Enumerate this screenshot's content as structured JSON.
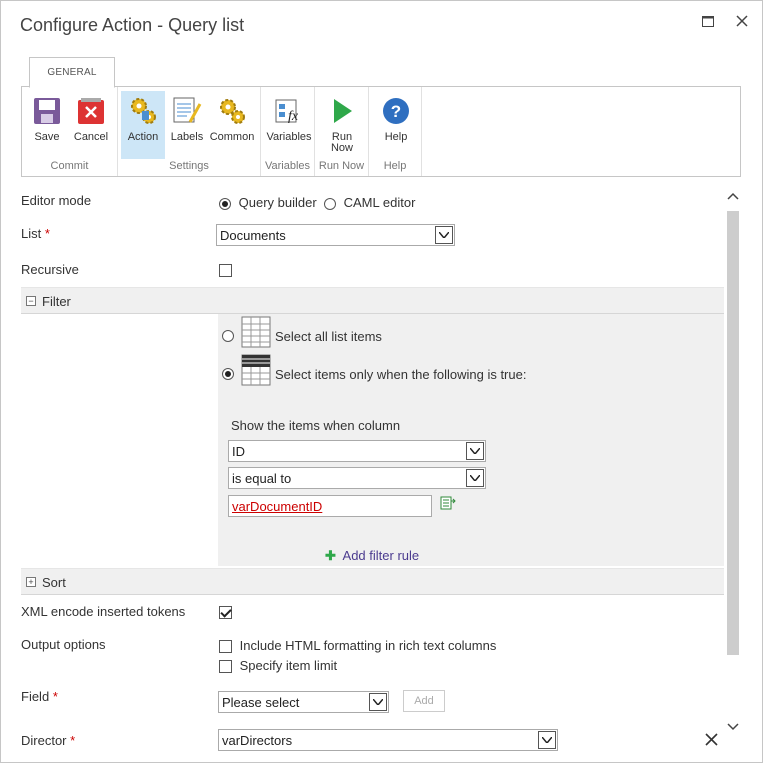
{
  "window": {
    "title": "Configure Action - Query list"
  },
  "tabs": {
    "general": "GENERAL"
  },
  "ribbon": {
    "save": "Save",
    "cancel": "Cancel",
    "commit_group": "Commit",
    "action": "Action",
    "labels": "Labels",
    "common": "Common",
    "settings_group": "Settings",
    "variables": "Variables",
    "variables_group": "Variables",
    "run_now": "Run Now",
    "run_now_group": "Run Now",
    "help": "Help",
    "help_group": "Help"
  },
  "form": {
    "editor_mode_label": "Editor mode",
    "query_builder": "Query builder",
    "caml_editor": "CAML editor",
    "list_label": "List",
    "list_value": "Documents",
    "recursive_label": "Recursive",
    "filter_title": "Filter",
    "select_all": "Select all list items",
    "select_when": "Select items only when the following is true:",
    "show_items_when": "Show the items when column",
    "column_value": "ID",
    "operator_value": "is equal to",
    "filter_value": "varDocumentID",
    "add_filter_rule": "Add filter rule",
    "sort_title": "Sort",
    "xml_encode_label": "XML encode inserted tokens",
    "output_options_label": "Output options",
    "include_html": "Include HTML formatting in rich text columns",
    "specify_limit": "Specify item limit",
    "field_label": "Field",
    "field_value": "Please select",
    "add_button": "Add",
    "director_label": "Director",
    "director_value": "varDirectors"
  },
  "required_marker": "*"
}
